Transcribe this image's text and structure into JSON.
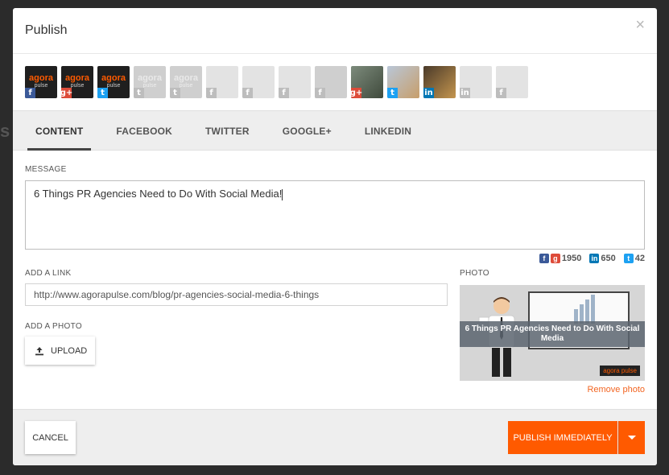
{
  "modal": {
    "title": "Publish",
    "close_symbol": "×"
  },
  "profiles": [
    {
      "kind": "agora",
      "name": "agora",
      "sub": "pulse",
      "network": "fb",
      "net_label": "f",
      "active": true
    },
    {
      "kind": "agora",
      "name": "agora",
      "sub": "pulse",
      "network": "gp",
      "net_label": "g+",
      "active": true
    },
    {
      "kind": "agora",
      "name": "agora",
      "sub": "pulse",
      "network": "tw",
      "net_label": "t",
      "active": true
    },
    {
      "kind": "agora",
      "name": "agora",
      "sub": "pulse",
      "network": "tw",
      "net_label": "t",
      "active": false
    },
    {
      "kind": "agora",
      "name": "agora",
      "sub": "pulse",
      "network": "tw",
      "net_label": "t",
      "active": false
    },
    {
      "kind": "logo",
      "name": "",
      "sub": "",
      "network": "fb",
      "net_label": "f",
      "active": false
    },
    {
      "kind": "logo",
      "name": "",
      "sub": "",
      "network": "fb",
      "net_label": "f",
      "active": false
    },
    {
      "kind": "pin",
      "name": "",
      "sub": "",
      "network": "fb",
      "net_label": "f",
      "active": false
    },
    {
      "kind": "photo",
      "name": "",
      "sub": "",
      "network": "fb",
      "net_label": "f",
      "active": false
    },
    {
      "kind": "photo1",
      "name": "",
      "sub": "",
      "network": "gp",
      "net_label": "g+",
      "active": true
    },
    {
      "kind": "photo2",
      "name": "",
      "sub": "",
      "network": "tw",
      "net_label": "t",
      "active": true
    },
    {
      "kind": "photo3",
      "name": "",
      "sub": "",
      "network": "li",
      "net_label": "in",
      "active": true
    },
    {
      "kind": "logo",
      "name": "",
      "sub": "",
      "network": "li",
      "net_label": "in",
      "active": false
    },
    {
      "kind": "flag",
      "name": "",
      "sub": "",
      "network": "fb",
      "net_label": "f",
      "active": false
    }
  ],
  "tabs": [
    "CONTENT",
    "FACEBOOK",
    "TWITTER",
    "GOOGLE+",
    "LINKEDIN"
  ],
  "active_tab": "CONTENT",
  "message": {
    "label": "MESSAGE",
    "value": "6 Things PR Agencies Need to Do With Social Media!"
  },
  "counters": {
    "fb_gp": "1950",
    "linkedin": "650",
    "twitter": "42"
  },
  "link": {
    "label": "ADD A LINK",
    "value": "http://www.agorapulse.com/blog/pr-agencies-social-media-6-things"
  },
  "photo_upload": {
    "label": "ADD A PHOTO",
    "button": "UPLOAD"
  },
  "photo": {
    "label": "PHOTO",
    "caption": "6 Things PR Agencies Need to Do With Social Media",
    "brand": "agora pulse",
    "remove": "Remove photo"
  },
  "footer": {
    "cancel": "CANCEL",
    "publish": "PUBLISH IMMEDIATELY"
  },
  "colors": {
    "accent": "#ff5a00",
    "facebook": "#3b5998",
    "google": "#dd4b39",
    "twitter": "#1da1f2",
    "linkedin": "#0077b5"
  }
}
